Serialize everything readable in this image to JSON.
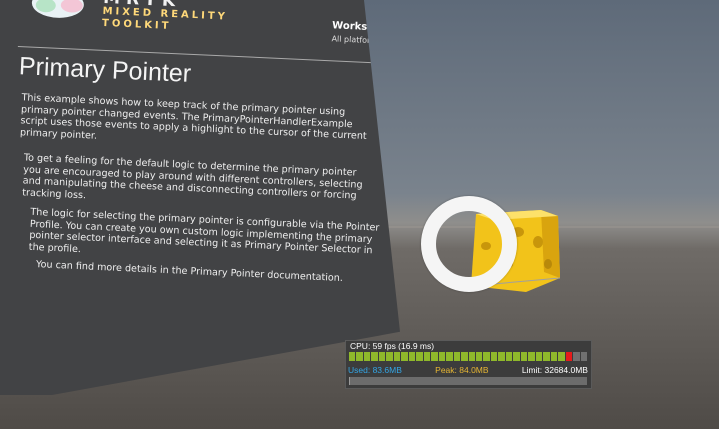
{
  "logo": {
    "name": "MRTK",
    "subtitle_line1": "MIXED REALITY",
    "subtitle_line2": "TOOLKIT"
  },
  "works_on": {
    "label": "Works on",
    "value": "All platforms"
  },
  "title": "Primary Pointer",
  "paragraphs": [
    "This example shows how to keep track of the primary pointer using primary pointer changed events. The PrimaryPointerHandlerExample script uses those events to apply a highlight to the cursor of the current primary pointer.",
    "To get a feeling for the default logic to determine the primary pointer you are encouraged to play around with different controllers, selecting and manipulating the cheese and disconnecting controllers or forcing tracking loss.",
    "The logic for selecting the primary pointer is configurable via the Pointer Profile. You can create you own custom logic implementing the primary pointer selector interface and selecting it as Primary Pointer Selector in the profile.",
    "You can find more details in the Primary Pointer documentation."
  ],
  "diagnostics": {
    "cpu": "CPU: 59 fps (16.9 ms)",
    "used": "Used: 83.6MB",
    "peak": "Peak: 84.0MB",
    "limit": "Limit: 32684.0MB",
    "bar_count": 32,
    "red_bar_index": 29,
    "memory_used_fraction": 0.0026,
    "colors": {
      "ok": "#8fb82b",
      "warn": "#e61b1b",
      "used": "#33a6e6",
      "peak": "#e6b633"
    }
  }
}
